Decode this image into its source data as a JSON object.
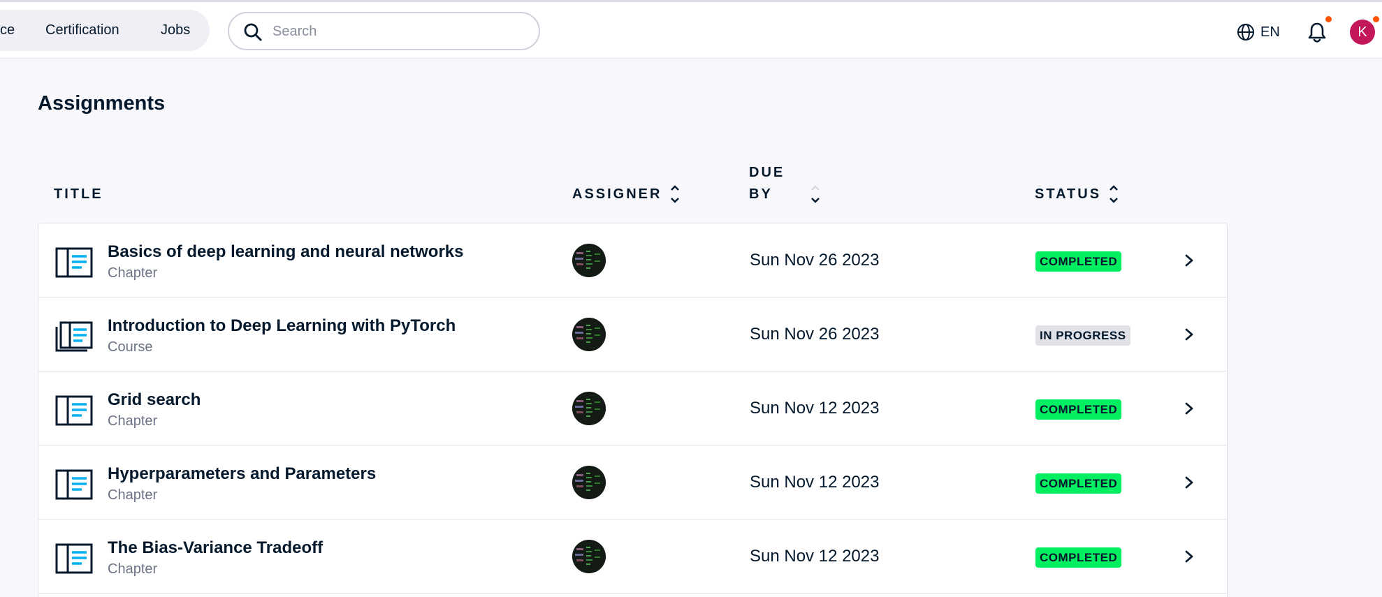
{
  "nav": {
    "items": [
      {
        "label": "ce"
      },
      {
        "label": "Certification"
      },
      {
        "label": "Jobs"
      }
    ]
  },
  "search": {
    "placeholder": "Search",
    "value": ""
  },
  "header": {
    "language": "EN",
    "user_initial": "K"
  },
  "page": {
    "title": "Assignments"
  },
  "table": {
    "columns": {
      "title": "TITLE",
      "assigner": "ASSIGNER",
      "due_line1": "DUE",
      "due_line2": "BY",
      "status": "STATUS"
    },
    "rows": [
      {
        "title": "Basics of deep learning and neural networks",
        "type": "Chapter",
        "due": "Sun Nov 26 2023",
        "status": "COMPLETED",
        "icon": "chapter-icon"
      },
      {
        "title": "Introduction to Deep Learning with PyTorch",
        "type": "Course",
        "due": "Sun Nov 26 2023",
        "status": "IN PROGRESS",
        "icon": "course-icon"
      },
      {
        "title": "Grid search",
        "type": "Chapter",
        "due": "Sun Nov 12 2023",
        "status": "COMPLETED",
        "icon": "chapter-icon"
      },
      {
        "title": "Hyperparameters and Parameters",
        "type": "Chapter",
        "due": "Sun Nov 12 2023",
        "status": "COMPLETED",
        "icon": "chapter-icon"
      },
      {
        "title": "The Bias-Variance Tradeoff",
        "type": "Chapter",
        "due": "Sun Nov 12 2023",
        "status": "COMPLETED",
        "icon": "chapter-icon"
      }
    ]
  },
  "colors": {
    "completed": "#03ef62",
    "in_progress": "#e1e1e8",
    "accent_icon": "#03b0f0",
    "notification_dot": "#ff5400",
    "avatar": "#c2185b"
  }
}
